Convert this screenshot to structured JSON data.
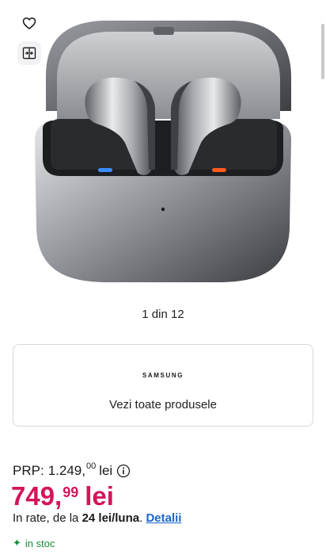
{
  "gallery": {
    "image_alt": "Samsung Galaxy Buds3 Pro silver earbuds in open charging case",
    "counter": "1 din 12",
    "actions": {
      "favorite_icon": "heart-icon",
      "compare_icon": "compare-icon"
    }
  },
  "brand": {
    "logo_text": "SAMSUNG",
    "link_label": "Vezi toate produsele"
  },
  "pricing": {
    "prp_label": "PRP:",
    "prp_int": "1.249,",
    "prp_dec": "00",
    "prp_currency": "lei",
    "price_int": "749,",
    "price_dec": "99",
    "price_currency": "lei",
    "installments_prefix": "In rate, de la ",
    "installments_amount": "24 lei/luna",
    "installments_suffix": ". ",
    "details_label": "Detalii"
  },
  "stock": {
    "icon": "sparkle-icon",
    "label": "in stoc",
    "color": "#1a8a3a"
  },
  "colors": {
    "price": "#d4145a",
    "link": "#1a66c9"
  }
}
